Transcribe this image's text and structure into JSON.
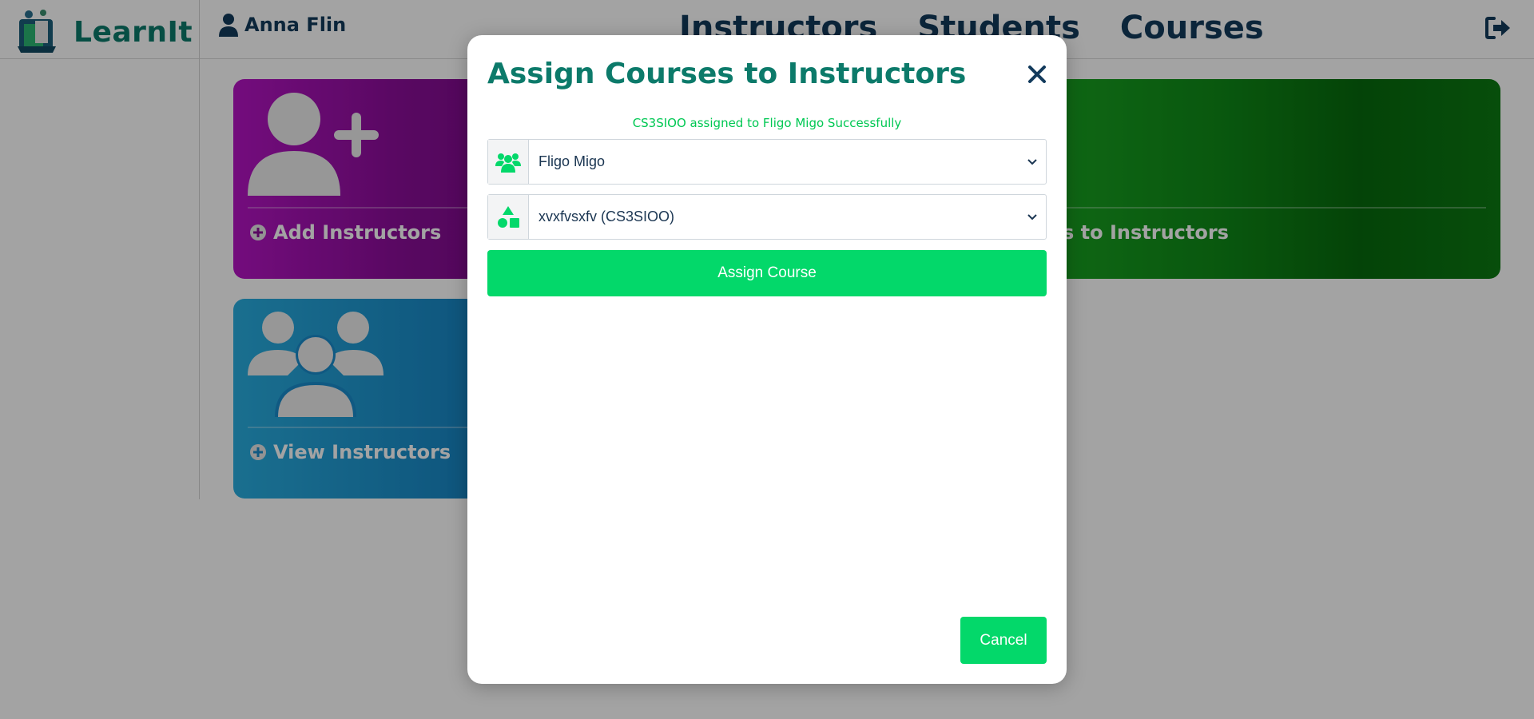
{
  "app": {
    "brand_name": "LearnIt"
  },
  "header": {
    "user_name": "Anna Flin",
    "nav": [
      {
        "label": "Instructors"
      },
      {
        "label": "Students"
      },
      {
        "label": "Courses"
      }
    ],
    "logout_icon": "sign-out-icon"
  },
  "cards": {
    "add_instructors": {
      "label": "Add Instructors",
      "icon": "user-plus-icon",
      "color": "#9b10aa"
    },
    "assign_courses": {
      "label": "Assign Courses to Instructors",
      "visible_label": "s to Instructors",
      "color": "#0f8a17"
    },
    "view_instructors": {
      "label": "View Instructors",
      "icon": "users-icon",
      "color": "#1a8ccc"
    }
  },
  "modal": {
    "title": "Assign Courses to Instructors",
    "success_message": "CS3SIOO assigned to Fligo Migo Successfully",
    "instructor_select": {
      "value": "Fligo Migo",
      "icon": "users-icon"
    },
    "course_select": {
      "value": "xvxfvsxfv (CS3SIOO)",
      "icon": "shapes-icon"
    },
    "assign_button": "Assign Course",
    "cancel_button": "Cancel",
    "accent_color": "#03d86a",
    "title_color": "#0c7a6a"
  }
}
